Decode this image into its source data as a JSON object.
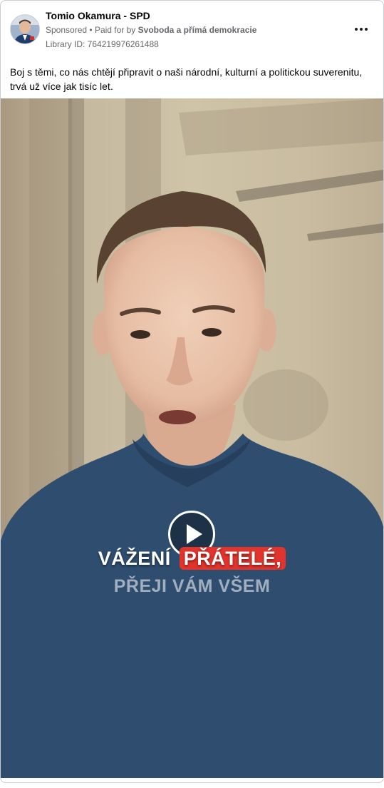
{
  "ad": {
    "page_name": "Tomio Okamura - SPD",
    "sponsored_label": "Sponsored",
    "paid_for_prefix": "Paid for by",
    "payer": "Svoboda a přímá demokracie",
    "separator": "•",
    "library_id": "Library ID: 764219976261488",
    "more_icon": "more-options-icon",
    "body_text": "Boj s těmi, co nás chtějí připravit o naši národní, kulturní a politickou suverenitu, trvá už více jak tisíc let."
  },
  "video": {
    "play_icon": "play-icon",
    "caption_line1_prefix": "VÁŽENÍ",
    "caption_line1_highlight": "PŘÁTELÉ,",
    "caption_line2": "PŘEJI VÁM VŠEM",
    "highlight_color": "#e0342c",
    "shirt_color": "#2f4d6e"
  }
}
